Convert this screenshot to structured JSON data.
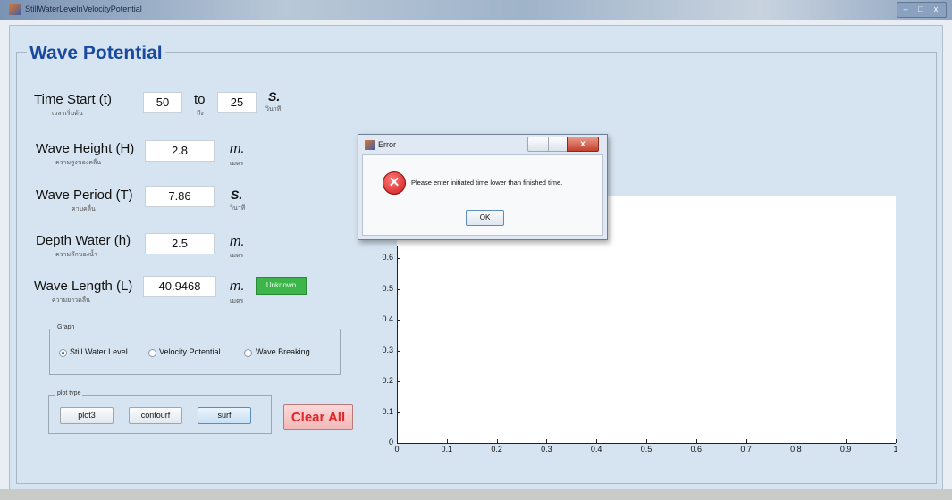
{
  "window": {
    "title": "StillWaterLevelnVelocityPotential",
    "controls": [
      "–",
      "□",
      "x"
    ]
  },
  "panel": {
    "title": "Wave Potential"
  },
  "time": {
    "label": "Time Start (t)",
    "sub": "เวลาเริ่มต้น",
    "start": "50",
    "to_label": "to",
    "to_sub": "ถึง",
    "end": "25",
    "unit": "S.",
    "unit_sub": "วินาที"
  },
  "height": {
    "label": "Wave Height (H)",
    "sub": "ความสูงของคลื่น",
    "value": "2.8",
    "unit": "m.",
    "unit_sub": "เมตร"
  },
  "period": {
    "label": "Wave Period (T)",
    "sub": "คาบคลื่น",
    "value": "7.86",
    "unit": "S.",
    "unit_sub": "วินาที"
  },
  "depth": {
    "label": "Depth Water (h)",
    "sub": "ความลึกของน้ำ",
    "value": "2.5",
    "unit": "m.",
    "unit_sub": "เมตร"
  },
  "length": {
    "label": "Wave Length (L)",
    "sub": "ความยาวคลื่น",
    "value": "40.9468",
    "unit": "m.",
    "unit_sub": "เมตร",
    "button": "Unknown"
  },
  "graph": {
    "title": "Graph",
    "options": [
      "Still Water Level",
      "Velocity Potential",
      "Wave Breaking"
    ],
    "selected": "Still Water Level"
  },
  "plot_type": {
    "title": "plot type",
    "buttons": [
      "plot3",
      "contourf",
      "surf"
    ],
    "selected": "surf"
  },
  "clear_label": "Clear All",
  "dialog": {
    "title": "Error",
    "message": "Please enter initiated time lower than finished time.",
    "ok": "OK",
    "close": "x"
  },
  "chart_data": {
    "type": "line",
    "title": "",
    "xlabel": "",
    "ylabel": "",
    "xlim": [
      0,
      1
    ],
    "ylim": [
      0,
      1
    ],
    "x_ticks": [
      "0",
      "0.1",
      "0.2",
      "0.3",
      "0.4",
      "0.5",
      "0.6",
      "0.7",
      "0.8",
      "0.9",
      "1"
    ],
    "y_ticks": [
      "0",
      "0.1",
      "0.2",
      "0.3",
      "0.4",
      "0.5",
      "0.6",
      "0.7",
      "0.8"
    ],
    "series": []
  }
}
